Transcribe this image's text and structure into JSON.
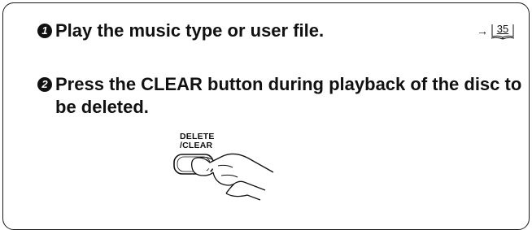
{
  "steps": [
    {
      "number": "1",
      "text": "Play the music type or user file."
    },
    {
      "number": "2",
      "text": "Press the CLEAR button during playback of the disc to be deleted."
    }
  ],
  "page_ref": {
    "arrow": "→",
    "page": "35"
  },
  "button_label": {
    "line1": "DELETE",
    "line2": "/CLEAR"
  }
}
